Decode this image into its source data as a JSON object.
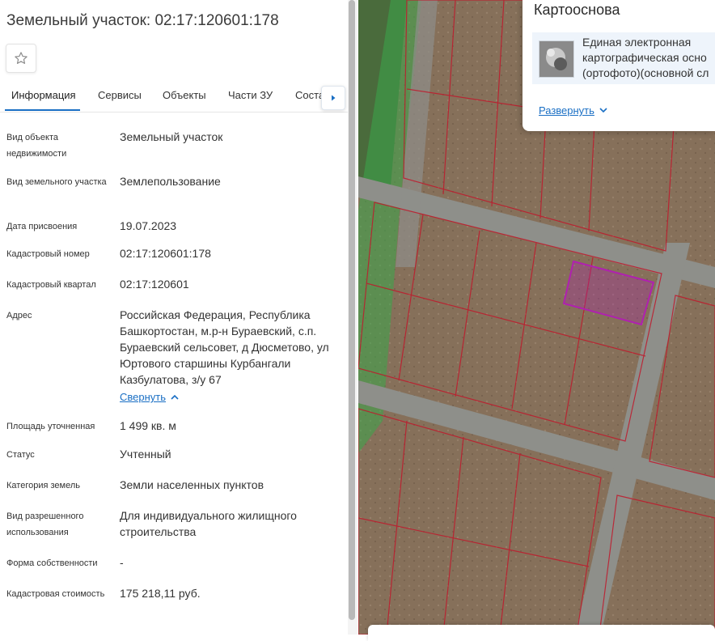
{
  "title": "Земельный участок: 02:17:120601:178",
  "tabs": [
    "Информация",
    "Сервисы",
    "Объекты",
    "Части ЗУ",
    "Состав"
  ],
  "fields": [
    {
      "label": "Вид объекта недвижимости",
      "value": "Земельный участок"
    },
    {
      "label": "Вид земельного участка",
      "value": "Землепользование"
    },
    {
      "label": "Дата присвоения",
      "value": "19.07.2023"
    },
    {
      "label": "Кадастровый номер",
      "value": "02:17:120601:178"
    },
    {
      "label": "Кадастровый квартал",
      "value": "02:17:120601"
    },
    {
      "label": "Адрес",
      "value": "Российская Федерация, Республика Башкортостан, м.р-н Бураевский, с.п. Бураевский сельсовет, д Дюсметово, ул Юртового старшины Курбангали Казбулатова, з/у 67"
    },
    {
      "label": "Площадь уточненная",
      "value": "1 499 кв. м"
    },
    {
      "label": "Статус",
      "value": "Учтенный"
    },
    {
      "label": "Категория земель",
      "value": "Земли населенных пунктов"
    },
    {
      "label": "Вид разрешенного использования",
      "value": "Для индивидуального жилищного строительства"
    },
    {
      "label": "Форма собственности",
      "value": "-"
    },
    {
      "label": "Кадастровая стоимость",
      "value": "175 218,11 руб."
    }
  ],
  "collapse_label": "Свернуть",
  "basemap": {
    "title": "Картооснова",
    "item_lines": [
      "Единая электронная",
      "картографическая осно",
      "(ортофото)(основной сл"
    ],
    "expand_label": "Развернуть"
  },
  "icons": {
    "star": "star-icon",
    "tab_next": "chevron-right-icon",
    "collapse": "chevron-up-icon",
    "expand": "chevron-down-icon"
  },
  "colors": {
    "accent": "#1a6fc4",
    "parcel_border": "#c0192c",
    "selected_parcel": "#b020b0",
    "green_zone": "#3aa84a"
  }
}
